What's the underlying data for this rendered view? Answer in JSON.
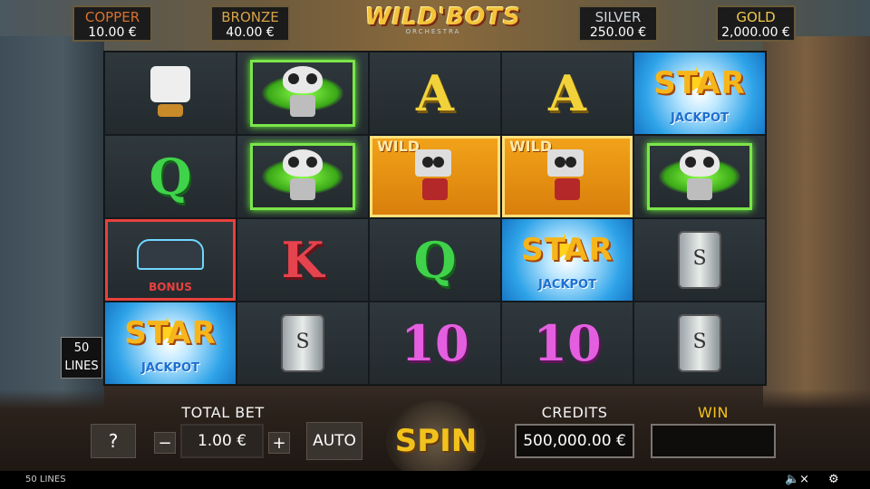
{
  "jackpots": [
    {
      "name": "COPPER",
      "value": "10.00 €"
    },
    {
      "name": "BRONZE",
      "value": "40.00 €"
    },
    {
      "name": "SILVER",
      "value": "250.00 €"
    },
    {
      "name": "GOLD",
      "value": "2,000.00 €"
    }
  ],
  "logo": {
    "title": "WILD'BOTS",
    "subtitle": "ORCHESTRA"
  },
  "reels": [
    [
      "robot-tall",
      "robot-green",
      "A",
      "A",
      "star-jackpot"
    ],
    [
      "Q",
      "robot-green",
      "wild",
      "wild",
      "robot-green"
    ],
    [
      "bonus",
      "K",
      "Q",
      "star-jackpot",
      "can"
    ],
    [
      "star-jackpot",
      "can",
      "10",
      "10",
      "can"
    ]
  ],
  "symbol_text": {
    "wild": "WILD",
    "star": "STAR",
    "jackpot": "JACKPOT",
    "bonus": "BONUS",
    "can": "S"
  },
  "lines_badge": {
    "count": "50",
    "unit": "LINES"
  },
  "controls": {
    "help": "?",
    "minus": "−",
    "plus": "+",
    "total_bet_label": "TOTAL BET",
    "total_bet_value": "1.00 €",
    "auto": "AUTO",
    "spin": "SPIN",
    "credits_label": "CREDITS",
    "credits_value": "500,000.00 €",
    "win_label": "WIN",
    "win_value": ""
  },
  "footer": {
    "lines_text": "50 LINES",
    "sound_icon": "speaker-muted-icon",
    "settings_icon": "gear-icon"
  },
  "colors": {
    "spin": "#f2c21c",
    "win_label": "#f4c21a"
  }
}
